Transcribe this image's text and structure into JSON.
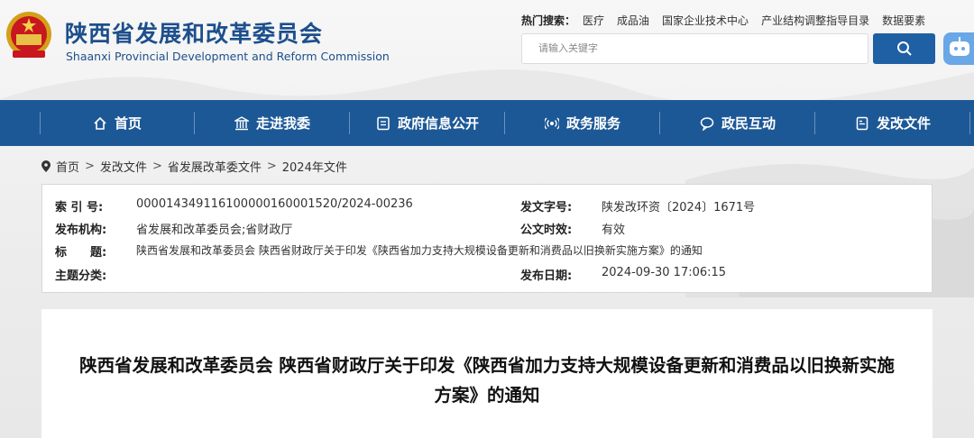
{
  "site": {
    "title": "陕西省发展和改革委员会",
    "subtitle": "Shaanxi Provincial Development and Reform Commission"
  },
  "hot_search": {
    "label": "热门搜索：",
    "items": [
      "医疗",
      "成品油",
      "国家企业技术中心",
      "产业结构调整指导目录",
      "数据要素"
    ]
  },
  "search": {
    "placeholder": "请输入关键字"
  },
  "nav": [
    {
      "label": "首页",
      "icon": "home-icon"
    },
    {
      "label": "走进我委",
      "icon": "building-icon"
    },
    {
      "label": "政府信息公开",
      "icon": "document-icon"
    },
    {
      "label": "政务服务",
      "icon": "broadcast-icon"
    },
    {
      "label": "政民互动",
      "icon": "chat-icon"
    },
    {
      "label": "发改文件",
      "icon": "file-icon"
    }
  ],
  "breadcrumb": [
    "首页",
    "发改文件",
    "省发展改革委文件",
    "2024年文件"
  ],
  "info": {
    "index_label": "索 引 号:",
    "index_value": "000014349116100000160001520/2024-00236",
    "doc_no_label": "发文字号:",
    "doc_no_value": "陕发改环资〔2024〕1671号",
    "publisher_label": "发布机构:",
    "publisher_value": "省发展和改革委员会;省财政厅",
    "validity_label": "公文时效:",
    "validity_value": "有效",
    "title_label": "标　　题:",
    "title_value": "陕西省发展和改革委员会 陕西省财政厅关于印发《陕西省加力支持大规模设备更新和消费品以旧换新实施方案》的通知",
    "topic_label": "主题分类:",
    "topic_value": "",
    "date_label": "发布日期:",
    "date_value": "2024-09-30 17:06:15"
  },
  "article": {
    "title": "陕西省发展和改革委员会 陕西省财政厅关于印发《陕西省加力支持大规模设备更新和消费品以旧换新实施方案》的通知"
  },
  "colors": {
    "nav_bg": "#1d5896",
    "brand": "#1d4f8c",
    "search_btn": "#1f5fa4"
  }
}
